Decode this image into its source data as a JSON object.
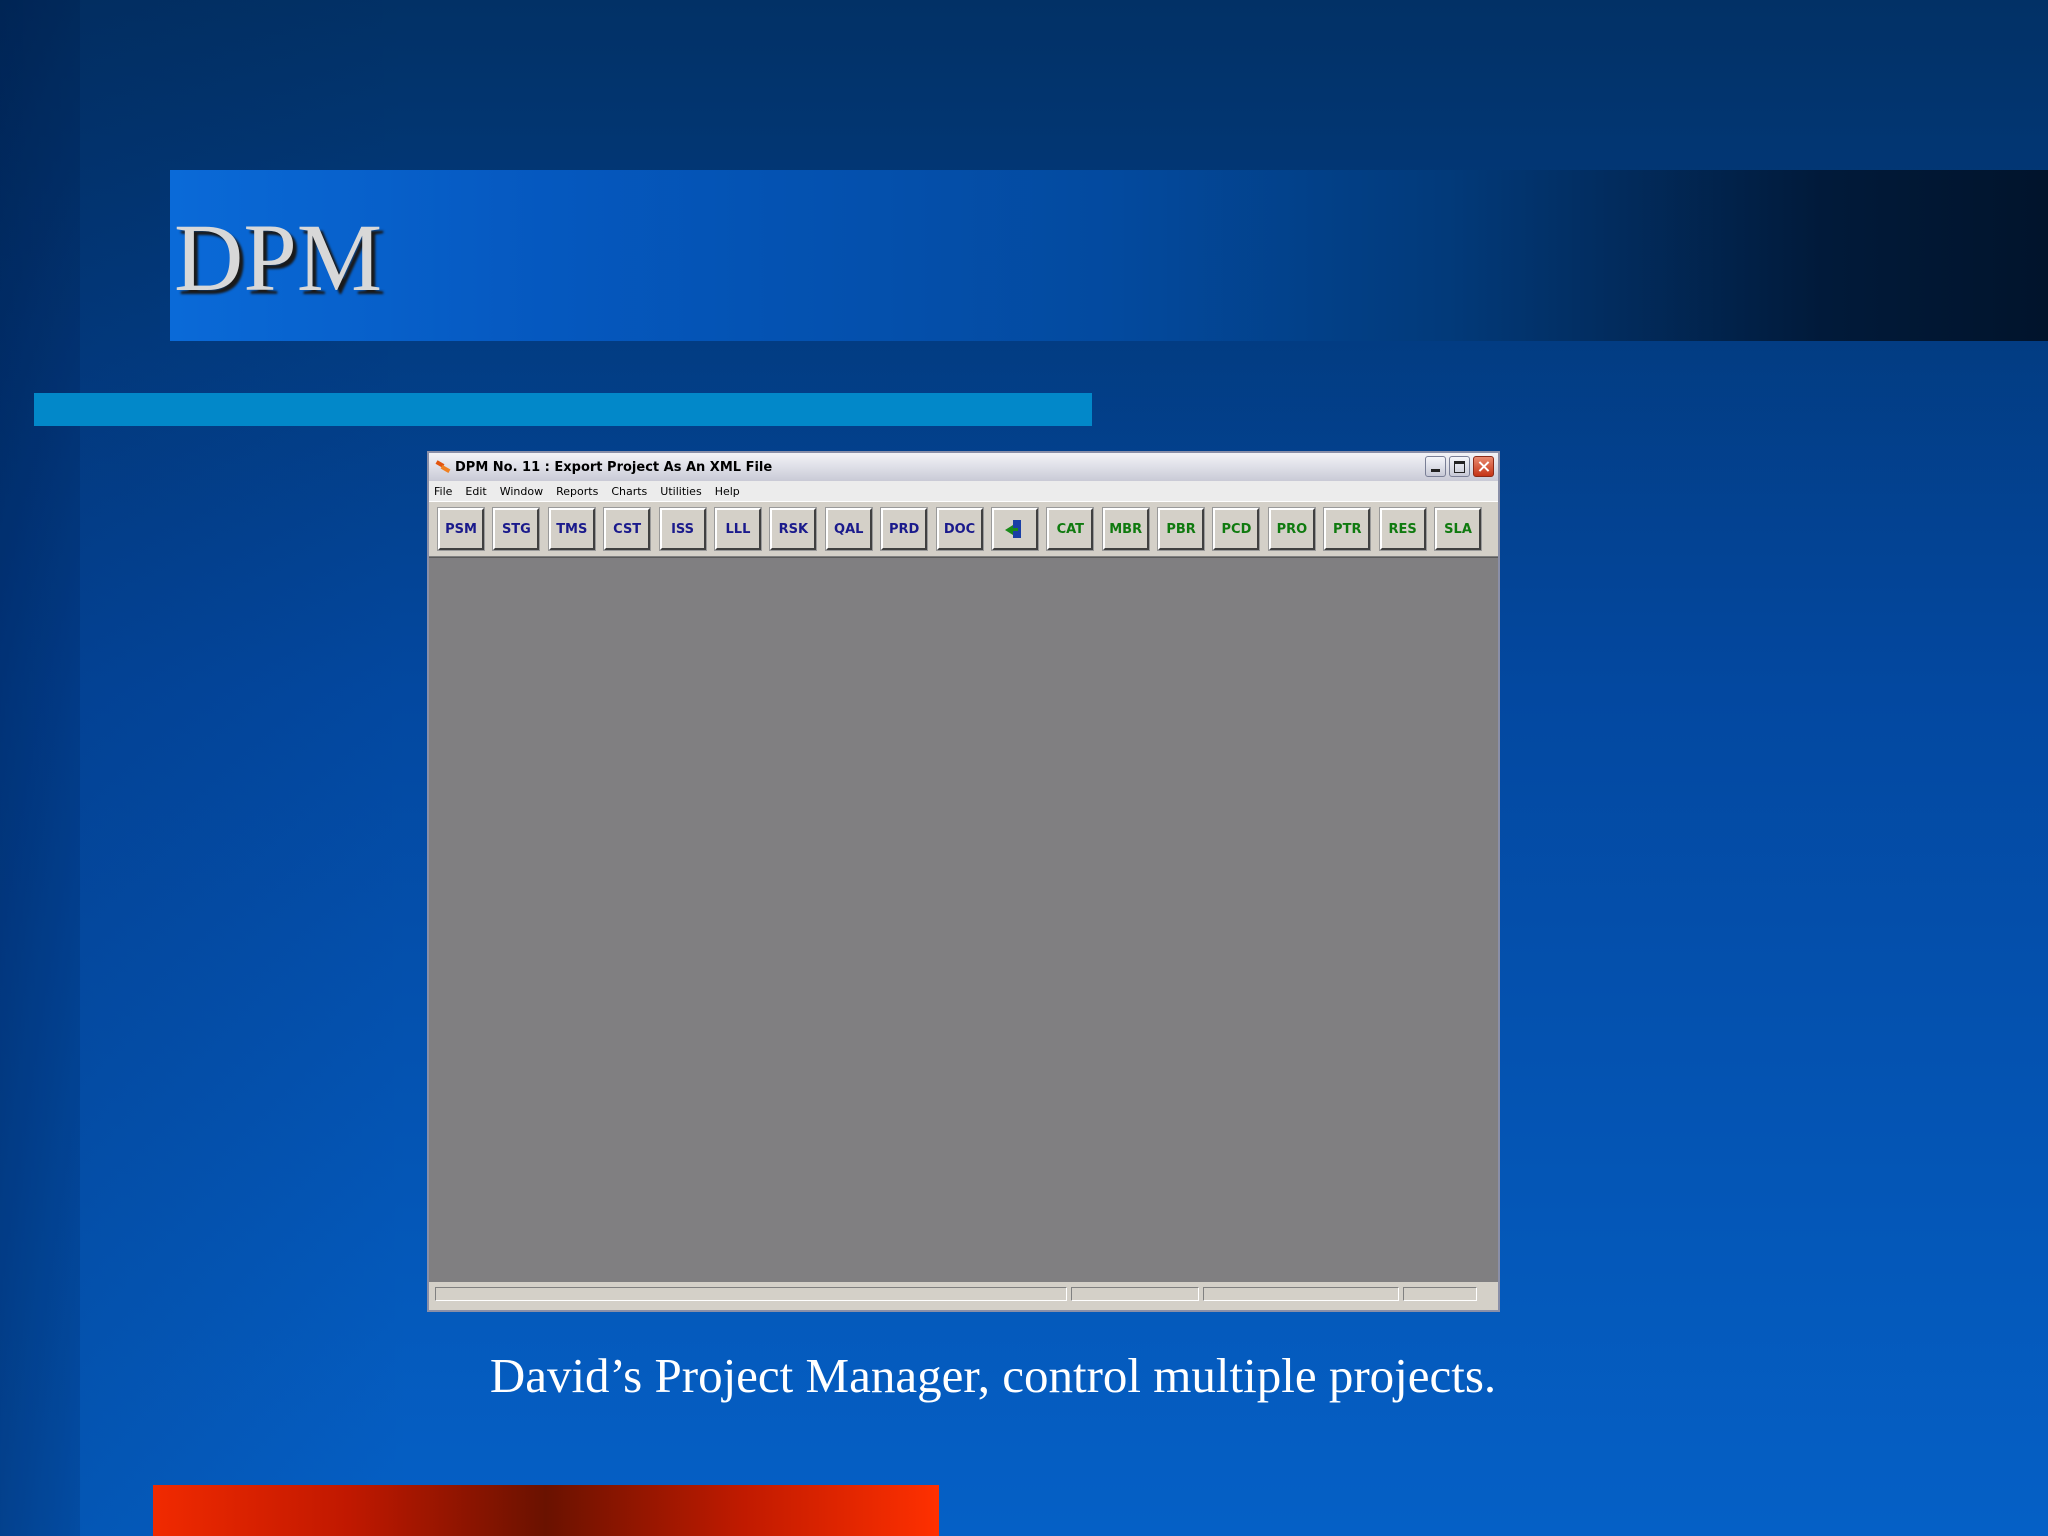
{
  "slide": {
    "title": "DPM",
    "caption": "David’s Project Manager, control multiple projects."
  },
  "window": {
    "title": "DPM No. 11 : Export Project As An XML File",
    "menus": [
      "File",
      "Edit",
      "Window",
      "Reports",
      "Charts",
      "Utilities",
      "Help"
    ],
    "toolbar_blue": [
      "PSM",
      "STG",
      "TMS",
      "CST",
      "ISS",
      "LLL",
      "RSK",
      "QAL",
      "PRD",
      "DOC"
    ],
    "toolbar_exit_icon": "exit-door-icon",
    "toolbar_green": [
      "CAT",
      "MBR",
      "PBR",
      "PCD",
      "PRO",
      "PTR",
      "RES",
      "SLA"
    ]
  },
  "colors": {
    "toolbar_blue_text": "#1a1a8c",
    "toolbar_green_text": "#0f7a0f",
    "workspace": "#807f81"
  }
}
